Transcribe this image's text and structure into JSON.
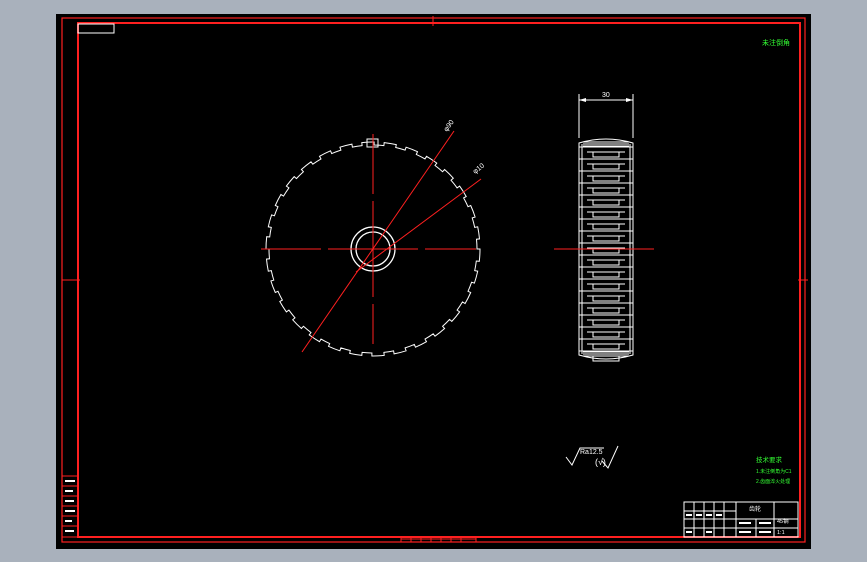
{
  "drawing": {
    "top_right_note": "未注倒角",
    "dim_outer_dia": "φ90",
    "dim_inner_dia": "φ10",
    "dim_width": "30",
    "roughness_value": "Ra12.5",
    "roughness_other": "(√)",
    "tech_req_title": "技术要求",
    "tech_req_line1": "1.未注倒角为C1",
    "tech_req_line2": "2.齿面淬火处理",
    "title_block_name": "齿轮",
    "title_block_material": "45钢",
    "title_block_scale": "1:1",
    "colors": {
      "background": "#000000",
      "frame": "#ff2020",
      "geometry": "#ffffff",
      "centerline": "#ff2020",
      "annotation_green": "#33ff33",
      "window_bg": "#a9b1bc"
    }
  }
}
